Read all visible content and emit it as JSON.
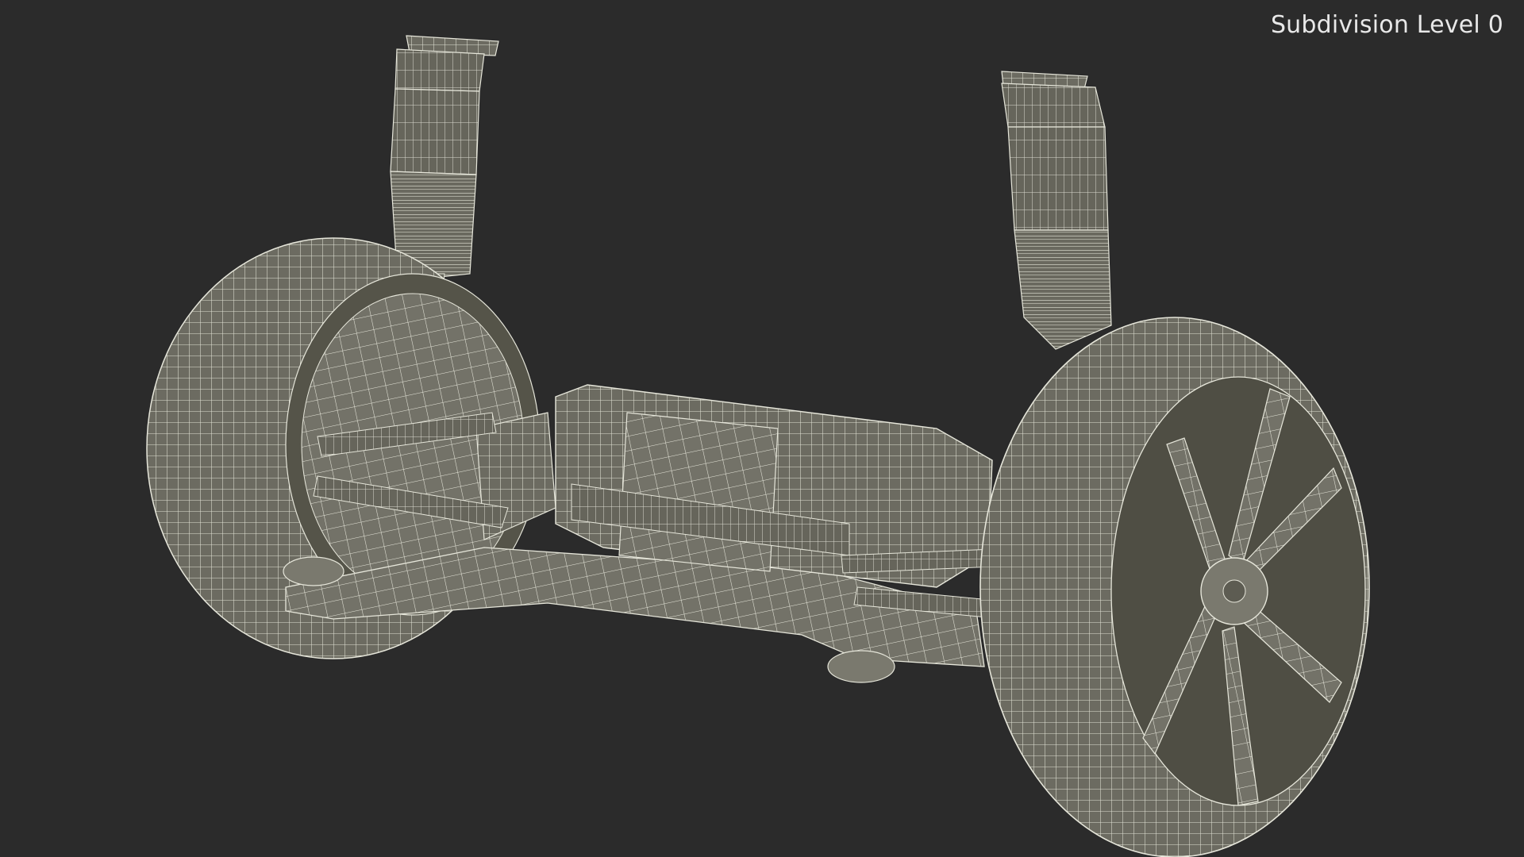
{
  "overlay": {
    "subdivision_label": "Subdivision Level 0"
  },
  "scene": {
    "subject": "wireframe-suspension-drivetrain",
    "background_color": "#2b2b2b",
    "mesh_fill_color": "#6f6e64",
    "mesh_line_color": "#e6e6dc"
  }
}
